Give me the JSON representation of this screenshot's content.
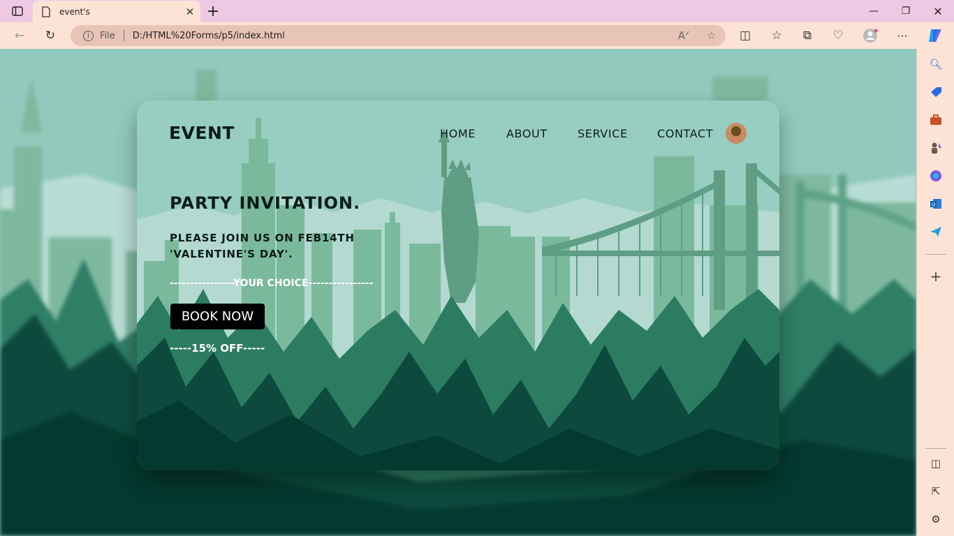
{
  "browser": {
    "tab_title": "event's",
    "address_prefix": "File",
    "url": "D:/HTML%20Forms/p5/index.html"
  },
  "page": {
    "logo": "EVENT",
    "nav": [
      "HOME",
      "ABOUT",
      "SERVICE",
      "CONTACT"
    ],
    "heading": "PARTY INVITATION.",
    "message": "PLEASE JOIN US ON FEB14TH 'VALENTINE'S DAY'.",
    "choice_line": "----------------YOUR CHOICE----------------",
    "cta_label": "BOOK NOW",
    "discount_line": "-----15% OFF-----"
  },
  "colors": {
    "sky": "#98cdc1",
    "forest_dark": "#04392f",
    "forest_mid": "#2a7a62",
    "button": "#000000"
  }
}
